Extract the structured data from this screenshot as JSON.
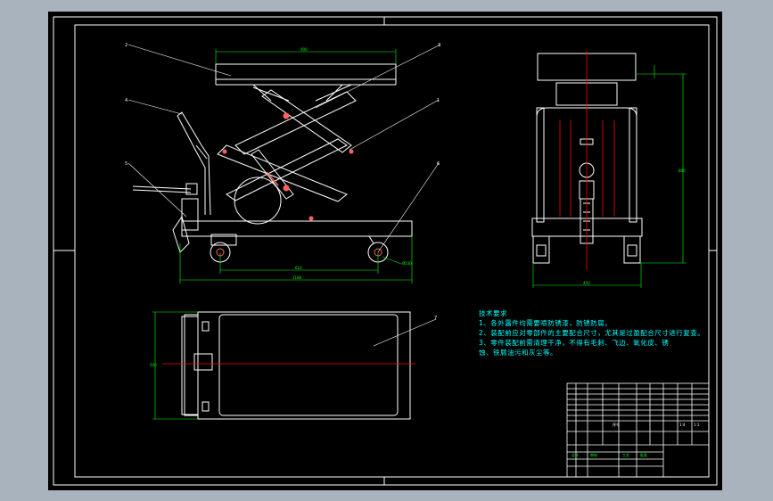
{
  "drawing": {
    "background": "#000000",
    "viewport_color": "#a9b3be",
    "line_color": "#ffffff",
    "dimension_color": "#00ff00",
    "center_line_color": "#ff0000",
    "joint_color": "#ff6060",
    "leader_numbers": [
      "2",
      "3",
      "4",
      "1",
      "5",
      "6",
      "7"
    ],
    "dimensions": {
      "platform_width": "900",
      "wheelbase": "610",
      "overall_length": "1186",
      "side_height": "800",
      "side_width": "450",
      "wheel_dia": "Ø100",
      "plan_width": "500"
    }
  },
  "tech_requirements": {
    "title": "技术要求",
    "lines": [
      "1、各外露件均需要喷防锈漆，防锈防腐。",
      "2、装配前应对零部件的主要配合尺寸，尤其是过盈配合尺寸进行复查。",
      "3、零件装配前需清理干净，不得有毛刺、飞边、氧化皮、锈",
      "蚀、铁屑油污和灰尘等。"
    ]
  },
  "title_block": {
    "scale": "1:4",
    "sheet": "1:1",
    "bottom_cells": [
      "设计",
      "审核",
      "工艺",
      "批准"
    ]
  }
}
